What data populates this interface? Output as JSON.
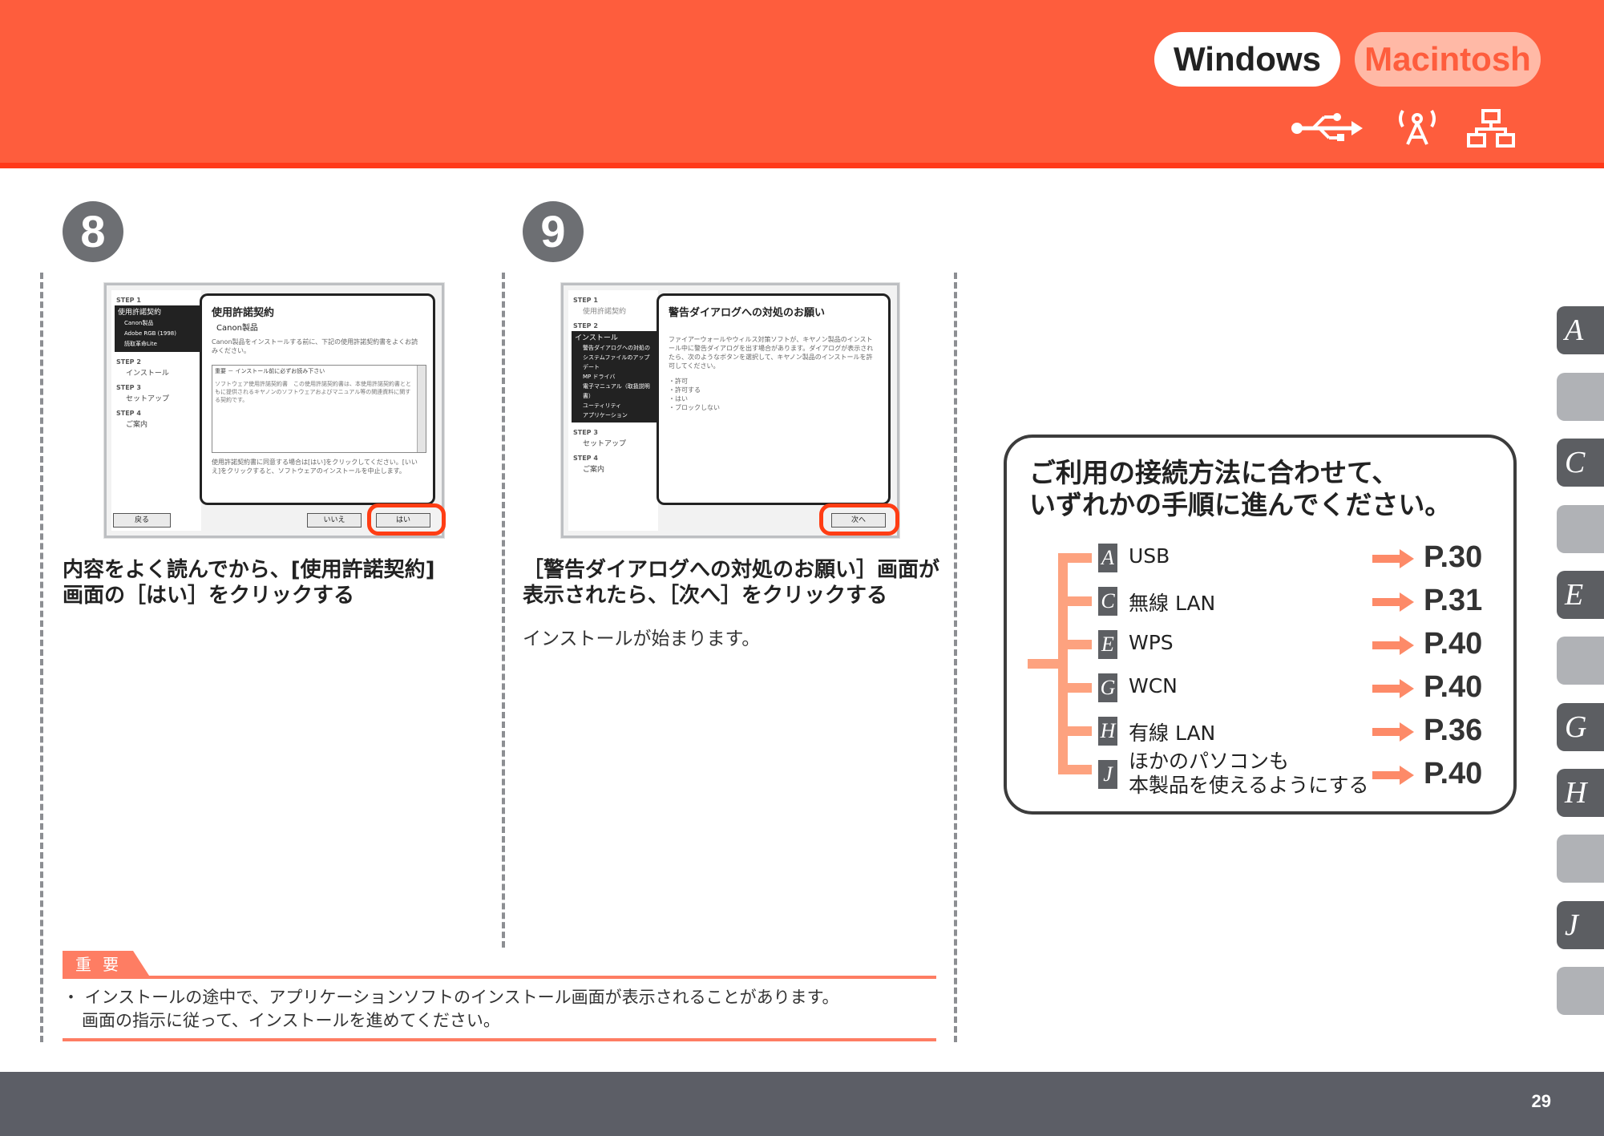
{
  "header": {
    "os_tabs": [
      "Windows",
      "Macintosh"
    ],
    "connection_icons": [
      "usb-icon",
      "wireless-icon",
      "network-icon"
    ]
  },
  "step8": {
    "number": "8",
    "title_line1": "内容をよく読んでから、[使用許諾契約]",
    "title_line2": "画面の［はい］をクリックする",
    "dialog": {
      "step1": "STEP 1",
      "side_items": [
        "使用許諾契約",
        "Canon製品",
        "Adobe RGB (1998)",
        "読取革命Lite"
      ],
      "step2": "STEP 2",
      "step2_item": "インストール",
      "step3": "STEP 3",
      "step3_item": "セットアップ",
      "step4": "STEP 4",
      "step4_item": "ご案内",
      "heading": "使用許諾契約",
      "sub": "Canon製品",
      "text": "Canon製品をインストールする前に、下記の使用許諾契約書をよくお読みください。",
      "box_title": "重要 － インストール前に必ずお読み下さい",
      "box_text": "ソフトウェア使用許諾契約書　この使用許諾契約書は、本使用許諾契約書とともに提供されるキヤノンのソフトウェアおよびマニュアル等の関連資料に関する契約です。",
      "bottom_text": "使用許諾契約書に同意する場合は[はい]をクリックしてください。[いいえ]をクリックすると、ソフトウェアのインストールを中止します。",
      "btn_back": "戻る",
      "btn_no": "いいえ",
      "btn_yes": "はい"
    }
  },
  "step9": {
    "number": "9",
    "title_line1": "［警告ダイアログへの対処のお願い］画面が",
    "title_line2": "表示されたら、［次へ］をクリックする",
    "note": "インストールが始まります。",
    "dialog": {
      "step1": "STEP 1",
      "step1_item": "使用許諾契約",
      "step2": "STEP 2",
      "side_items": [
        "インストール",
        "警告ダイアログへの対処の",
        "システムファイルのアップデート",
        "MP ドライバ",
        "電子マニュアル（取扱説明書）",
        "ユーティリティ",
        "アプリケーション"
      ],
      "step3": "STEP 3",
      "step3_item": "セットアップ",
      "step4": "STEP 4",
      "step4_item": "ご案内",
      "heading": "警告ダイアログへの対処のお願い",
      "text": "ファイアーウォールやウィルス対策ソフトが、キヤノン製品のインストール中に警告ダイアログを出す場合があります。ダイアログが表示されたら、次のようなボタンを選択して、キヤノン製品のインストールを許可してください。",
      "options": [
        "・許可",
        "・許可する",
        "・はい",
        "・ブロックしない"
      ],
      "btn_next": "次へ"
    }
  },
  "important": {
    "tag": "重要",
    "line1": "・ インストールの途中で、アプリケーションソフトのインストール画面が表示されることがあります。",
    "line2": "画面の指示に従って、インストールを進めてください。"
  },
  "choice_box": {
    "title_line1": "ご利用の接続方法に合わせて、",
    "title_line2": "いずれかの手順に進んでください。",
    "rows": [
      {
        "letter": "A",
        "label": "USB",
        "page": "P.30"
      },
      {
        "letter": "C",
        "label": "無線 LAN",
        "page": "P.31"
      },
      {
        "letter": "E",
        "label": "WPS",
        "page": "P.40"
      },
      {
        "letter": "G",
        "label": "WCN",
        "page": "P.40"
      },
      {
        "letter": "H",
        "label": "有線 LAN",
        "page": "P.36"
      },
      {
        "letter": "J",
        "label": "ほかのパソコンも",
        "label2": "本製品を使えるようにする",
        "page": "P.40"
      }
    ]
  },
  "side_tabs": [
    "A",
    "",
    "C",
    "",
    "E",
    "",
    "G",
    "H",
    "",
    "J",
    ""
  ],
  "footer": {
    "page_number": "29"
  },
  "colors": {
    "accent": "#fe5d3d",
    "ring": "#ff3d14",
    "bracket": "#fda27f",
    "footer": "#5c5e66"
  }
}
